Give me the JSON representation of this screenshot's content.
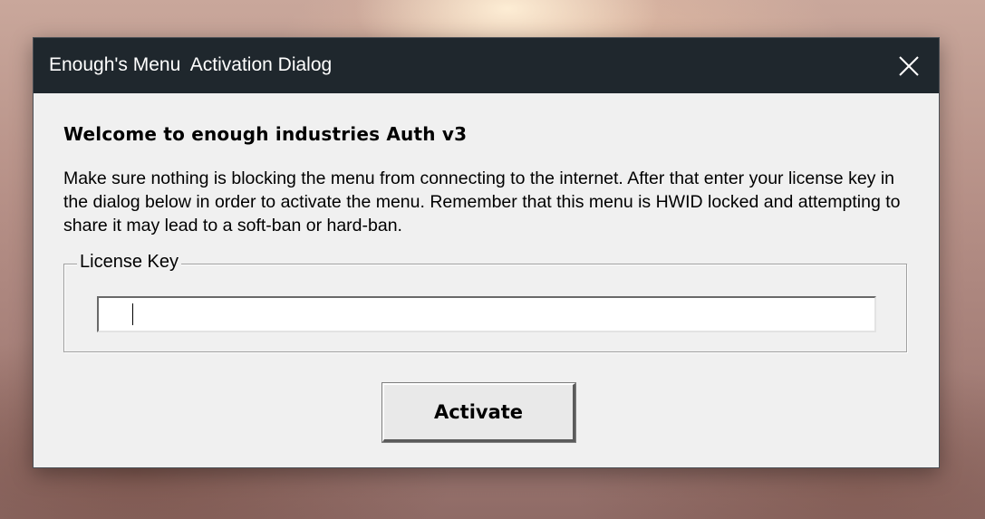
{
  "dialog": {
    "title": "Enough's Menu  Activation Dialog",
    "close_icon": "close-icon",
    "heading": "Welcome to enough industries Auth v3",
    "message": "Make sure nothing is blocking the menu from connecting to the internet. After that enter your license key in the dialog below in order to activate the menu. Remember that this menu is HWID locked and attempting to share it may lead to a soft-ban or hard-ban.",
    "license_group_label": "License Key",
    "license_input_value": "",
    "activate_label": "Activate"
  },
  "colors": {
    "titlebar": "#1f272d",
    "dialog_background": "#f0f0f0",
    "title_text": "#ffffff"
  }
}
